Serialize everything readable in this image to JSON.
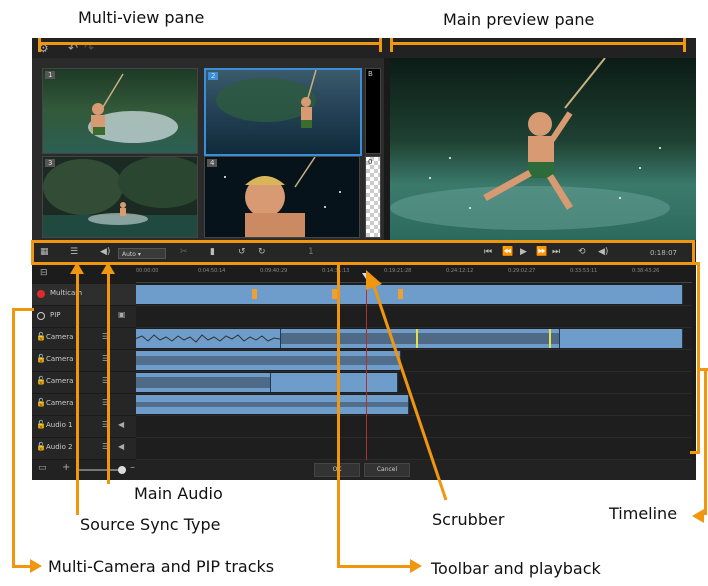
{
  "callouts": {
    "multi_view": "Multi-view pane",
    "main_preview": "Main preview pane",
    "main_audio": "Main Audio",
    "source_sync": "Source Sync Type",
    "scrubber": "Scrubber",
    "timeline": "Timeline",
    "tracks": "Multi-Camera and PIP tracks",
    "toolbar": "Toolbar and playback"
  },
  "multiview": {
    "cameras": [
      "1",
      "2",
      "3",
      "4"
    ],
    "side_labels": [
      "B",
      "0"
    ],
    "selected": "2"
  },
  "toolbar": {
    "audio_select": "Auto",
    "angle_value": "1",
    "timecode": "0:18:07",
    "timecode_unit": "07"
  },
  "ruler": {
    "ticks": [
      "00:00:00",
      "0:04:50:14",
      "0:09:40:29",
      "0:14:31:13",
      "0:19:21:28",
      "0:24:12:12",
      "0:29:02:27",
      "0:33:53:11",
      "0:38:43:26"
    ]
  },
  "tracks": {
    "multicam": "Multicam",
    "pip": "PIP",
    "camera1": "Camera",
    "camera2": "Camera",
    "camera3": "Camera",
    "camera4": "Camera",
    "audio1": "Audio 1",
    "audio2": "Audio 2"
  },
  "buttons": {
    "ok": "OK",
    "cancel": "Cancel"
  },
  "colors": {
    "callout_arrow": "#f0960f",
    "clip": "#6e9ccb",
    "selection": "#3b8fd9"
  }
}
